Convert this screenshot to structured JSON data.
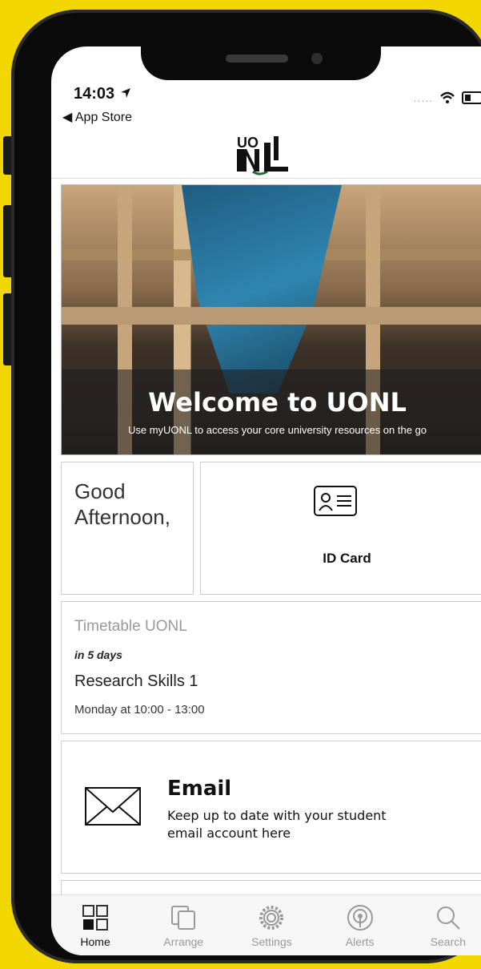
{
  "status": {
    "time": "14:03",
    "back_label": "◀ App Store",
    "signal_dots": "....."
  },
  "logo": {
    "alt": "UONL"
  },
  "hero": {
    "title": "Welcome to UONL",
    "subtitle": "Use myUONL to access your core university resources on the go"
  },
  "greeting": {
    "line1": "Good",
    "line2": "Afternoon,"
  },
  "id_card": {
    "label": "ID Card",
    "icon": "id-card-icon"
  },
  "timetable": {
    "title": "Timetable UONL",
    "when": "in 5 days",
    "course": "Research Skills 1",
    "time": "Monday at 10:00 - 13:00"
  },
  "email": {
    "title": "Email",
    "description": "Keep up to date with your student email account here",
    "icon": "envelope-icon"
  },
  "tabs": [
    {
      "label": "Home",
      "icon": "home-grid-icon",
      "active": true
    },
    {
      "label": "Arrange",
      "icon": "arrange-icon",
      "active": false
    },
    {
      "label": "Settings",
      "icon": "gear-icon",
      "active": false
    },
    {
      "label": "Alerts",
      "icon": "broadcast-icon",
      "active": false
    },
    {
      "label": "Search",
      "icon": "search-icon",
      "active": false
    }
  ],
  "colors": {
    "background": "#f2d600",
    "frame": "#0b0b0b",
    "active_tab": "#111111",
    "inactive_tab": "#999999"
  }
}
